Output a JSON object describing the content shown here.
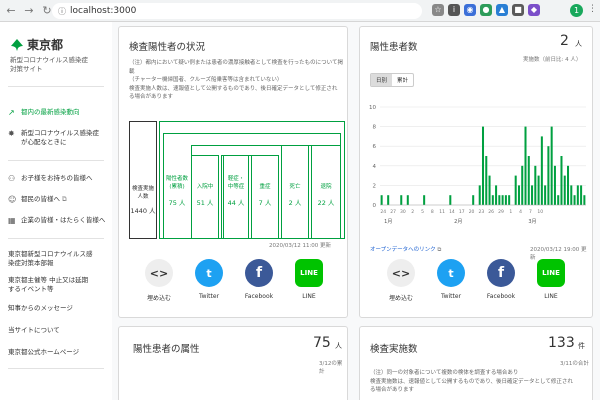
{
  "browser": {
    "url": "localhost:3000",
    "nav": [
      "←",
      "→",
      "↻",
      "⌂"
    ],
    "extensions": [
      {
        "name": "star-icon",
        "glyph": "☆",
        "color": "#888888"
      },
      {
        "name": "info-icon",
        "glyph": "i",
        "color": "#555555"
      },
      {
        "name": "extension-icon-1",
        "glyph": "◉",
        "color": "#3b6fd8"
      },
      {
        "name": "extension-icon-2",
        "glyph": "●",
        "color": "#2d9c5a"
      },
      {
        "name": "extension-icon-3",
        "glyph": "▲",
        "color": "#2a7fd4"
      },
      {
        "name": "extension-icon-4",
        "glyph": "■",
        "color": "#5a5a5a"
      },
      {
        "name": "extension-icon-5",
        "glyph": "◆",
        "color": "#7b4fc9"
      }
    ],
    "profile_initial": "1"
  },
  "sidebar": {
    "logo": "東京都",
    "subtitle": "新型コロナウイルス感染症\n対策サイト",
    "items": [
      {
        "label": "都内の最新感染動向",
        "icon": "trend-icon",
        "glyph": "↗",
        "active": true
      },
      {
        "label": "新型コロナウイルス感染症\nが心配なときに",
        "icon": "virus-icon",
        "glyph": "✸",
        "active": false
      },
      {
        "label": "お子様をお持ちの皆様へ",
        "icon": "family-icon",
        "glyph": "👪",
        "active": false
      },
      {
        "label": "都民の皆様へ",
        "icon": "people-icon",
        "glyph": "☺",
        "active": false
      },
      {
        "label": "企業の皆様・はたらく皆様へ",
        "icon": "building-icon",
        "glyph": "▦",
        "active": false
      }
    ],
    "links": [
      {
        "label": "東京都新型コロナウイルス感\n染症対策本部報"
      },
      {
        "label": "東京都主催等 中止又は延期\nするイベント等"
      },
      {
        "label": "知事からのメッセージ"
      },
      {
        "label": "当サイトについて"
      },
      {
        "label": "東京都公式ホームページ"
      }
    ]
  },
  "inspection_card": {
    "title": "検査陽性者の状況",
    "note": "（注）都内において疑い例または患者の濃厚接触者として検査を行ったものについて掲\n載\n（チャーター機帰国者、クルーズ船乗客等は含まれていない）\n検査実施人数は、速報値として公開するものであり、後日確定データとして修正され\nる場合があります",
    "boxes": [
      {
        "label": "検査実施\n人数",
        "value": "1440 人",
        "dark": true
      },
      {
        "label": "陽性者数\n(累積)",
        "value": "75 人",
        "dark": false
      },
      {
        "label": "入院中",
        "value": "51 人",
        "dark": false
      },
      {
        "label": "軽症・\n中等症",
        "value": "44 人",
        "dark": false
      },
      {
        "label": "重症",
        "value": "7 人",
        "dark": false
      },
      {
        "label": "死亡",
        "value": "2 人",
        "dark": false
      },
      {
        "label": "退院",
        "value": "22 人",
        "dark": false
      }
    ],
    "updated": "2020/03/12 11:00 更新",
    "share": [
      {
        "label": "埋め込む",
        "icon": "embed-icon",
        "glyph": "<>",
        "color": "#eeeeee",
        "fg": "#333333"
      },
      {
        "label": "Twitter",
        "icon": "twitter-icon",
        "glyph": "t",
        "color": "#1da1f2",
        "fg": "#ffffff"
      },
      {
        "label": "Facebook",
        "icon": "facebook-icon",
        "glyph": "f",
        "color": "#3b5998",
        "fg": "#ffffff"
      },
      {
        "label": "LINE",
        "icon": "line-icon",
        "glyph": "LINE",
        "color": "#00c300",
        "fg": "#ffffff"
      }
    ]
  },
  "patients_card": {
    "title": "陽性患者数",
    "value": "2",
    "unit": "人",
    "sub": "実施数（前日比: 4 人）",
    "toggle": [
      "日別",
      "累計"
    ],
    "opendata": "オープンデータへのリンク",
    "updated": "2020/03/12 19:00 更新",
    "share": [
      {
        "label": "埋め込む",
        "icon": "embed-icon",
        "glyph": "<>",
        "color": "#eeeeee",
        "fg": "#333333"
      },
      {
        "label": "Twitter",
        "icon": "twitter-icon",
        "glyph": "t",
        "color": "#1da1f2",
        "fg": "#ffffff"
      },
      {
        "label": "Facebook",
        "icon": "facebook-icon",
        "glyph": "f",
        "color": "#3b5998",
        "fg": "#ffffff"
      },
      {
        "label": "LINE",
        "icon": "line-icon",
        "glyph": "LINE",
        "color": "#00c300",
        "fg": "#ffffff"
      }
    ]
  },
  "attribute_card": {
    "title": "陽性患者の属性",
    "value": "75",
    "unit": "人",
    "sub": "3/12の累計"
  },
  "tests_card": {
    "title": "検査実施数",
    "value": "133",
    "unit": "件",
    "sub": "3/11の合計",
    "note": "（注）同一の対象者について複数の検体を調査する場合あり\n検査実施数は、速報値として公開するものであり、後日確定データとして修正され\nる場合があります"
  },
  "chart_data": {
    "type": "bar",
    "ylim": [
      0,
      10
    ],
    "yticks": [
      0,
      2,
      4,
      6,
      8,
      10
    ],
    "xticks": [
      "24",
      "27",
      "30",
      "2",
      "5",
      "8",
      "11",
      "14",
      "17",
      "20",
      "23",
      "26",
      "29",
      "1",
      "4",
      "7",
      "10"
    ],
    "month_labels": [
      "1月",
      "2月",
      "3月"
    ],
    "color": "#00a040",
    "values": [
      1,
      0,
      1,
      0,
      0,
      0,
      1,
      0,
      1,
      0,
      0,
      0,
      0,
      1,
      0,
      0,
      0,
      0,
      0,
      0,
      0,
      1,
      0,
      0,
      0,
      0,
      0,
      0,
      1,
      0,
      2,
      8,
      5,
      3,
      1,
      2,
      1,
      1,
      1,
      1,
      0,
      3,
      2,
      4,
      8,
      5,
      2,
      4,
      3,
      7,
      2,
      6,
      8,
      4,
      1,
      5,
      3,
      4,
      2,
      1,
      2,
      2,
      1
    ]
  }
}
